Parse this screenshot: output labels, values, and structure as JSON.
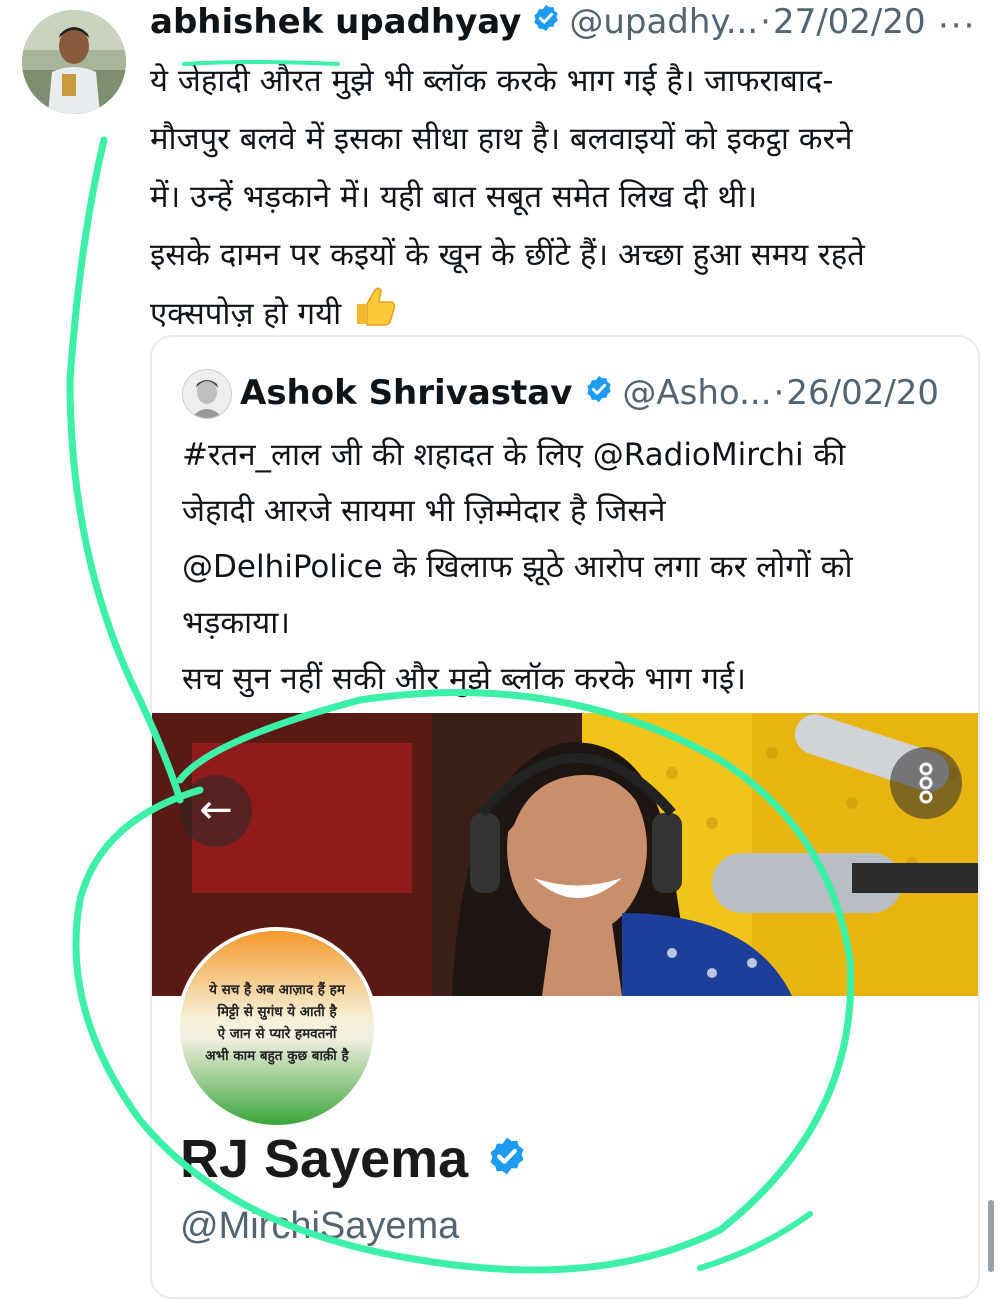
{
  "main_tweet": {
    "author_name": "abhishek upadhyay",
    "handle": "@upadhy...",
    "separator": "·",
    "date": "27/02/20",
    "more_label": "···",
    "lines": [
      "ये जेहादी औरत मुझे भी ब्लॉक करके भाग गई है। जाफराबाद-",
      "मौजपुर बलवे में इसका सीधा हाथ है। बलवाइयों को इकट्ठा करने",
      "में। उन्हें भड़काने में। यही बात सबूत समेत लिख दी थी।",
      "इसके दामन पर कइयों के खून के छींटे हैं। अच्छा हुआ समय रहते",
      "एक्सपोज़ हो गयी"
    ],
    "emoji": "👍"
  },
  "quoted_tweet": {
    "author_name": "Ashok Shrivastav",
    "handle": "@Asho...",
    "separator": "·",
    "date": "26/02/20",
    "lines": [
      "#रतन_लाल जी की शहादत के लिए @RadioMirchi की",
      "जेहादी आरजे सायमा भी ज़िम्मेदार है जिसने",
      "@DelhiPolice के खिलाफ झूठे आरोप लगा कर लोगों को",
      "भड़काया।",
      "सच सुन नहीं सकी और मुझे ब्लॉक करके भाग गई।"
    ]
  },
  "profile_card": {
    "back_icon": "←",
    "picture_text": [
      "ये सच है अब आज़ाद हैं हम",
      "मिट्टी से सुगंध ये आती है",
      "ऐ जान से प्यारे हमवतनों",
      "अभी काम बहुत कुछ बाक़ी है"
    ],
    "display_name": "RJ Sayema",
    "handle": "@MirchiSayema"
  },
  "colors": {
    "verified_blue": "#1d9bf0",
    "annotation_green": "#3df0a8",
    "muted_text": "#536471"
  },
  "icons": [
    "verified-badge-icon",
    "more-options-icon",
    "back-arrow-icon",
    "thumbs-up-emoji"
  ]
}
